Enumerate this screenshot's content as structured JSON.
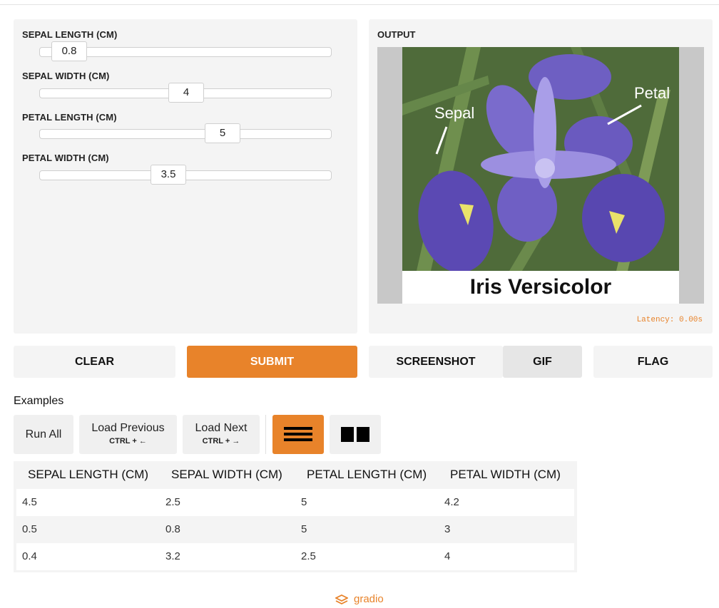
{
  "inputs": [
    {
      "label": "SEPAL LENGTH (CM)",
      "value": "0.8",
      "level": 0.08
    },
    {
      "label": "SEPAL WIDTH (CM)",
      "value": "4",
      "level": 0.5
    },
    {
      "label": "PETAL LENGTH (CM)",
      "value": "5",
      "level": 0.63
    },
    {
      "label": "PETAL WIDTH (CM)",
      "value": "3.5",
      "level": 0.44
    }
  ],
  "output": {
    "label": "OUTPUT",
    "caption": "Iris Versicolor",
    "image_labels": {
      "sepal": "Sepal",
      "petal": "Petal"
    },
    "latency": "Latency: 0.00s"
  },
  "buttons": {
    "clear": "CLEAR",
    "submit": "SUBMIT",
    "screenshot": "SCREENSHOT",
    "gif": "GIF",
    "flag": "FLAG"
  },
  "examples": {
    "title": "Examples",
    "run_all": "Run All",
    "load_previous": "Load Previous",
    "load_previous_shortcut": "CTRL + ←",
    "load_next": "Load Next",
    "load_next_shortcut": "CTRL + →",
    "headers": [
      "SEPAL LENGTH (CM)",
      "SEPAL WIDTH (CM)",
      "PETAL LENGTH (CM)",
      "PETAL WIDTH (CM)"
    ],
    "rows": [
      [
        "4.5",
        "2.5",
        "5",
        "4.2"
      ],
      [
        "0.5",
        "0.8",
        "5",
        "3"
      ],
      [
        "0.4",
        "3.2",
        "2.5",
        "4"
      ]
    ]
  },
  "footer": {
    "brand": "gradio"
  },
  "colors": {
    "accent": "#e8832a",
    "panel": "#f4f4f4"
  },
  "icons": {
    "list_view": "list-view-icon",
    "grid_view": "grid-view-icon",
    "logo": "gradio-logo-icon"
  }
}
